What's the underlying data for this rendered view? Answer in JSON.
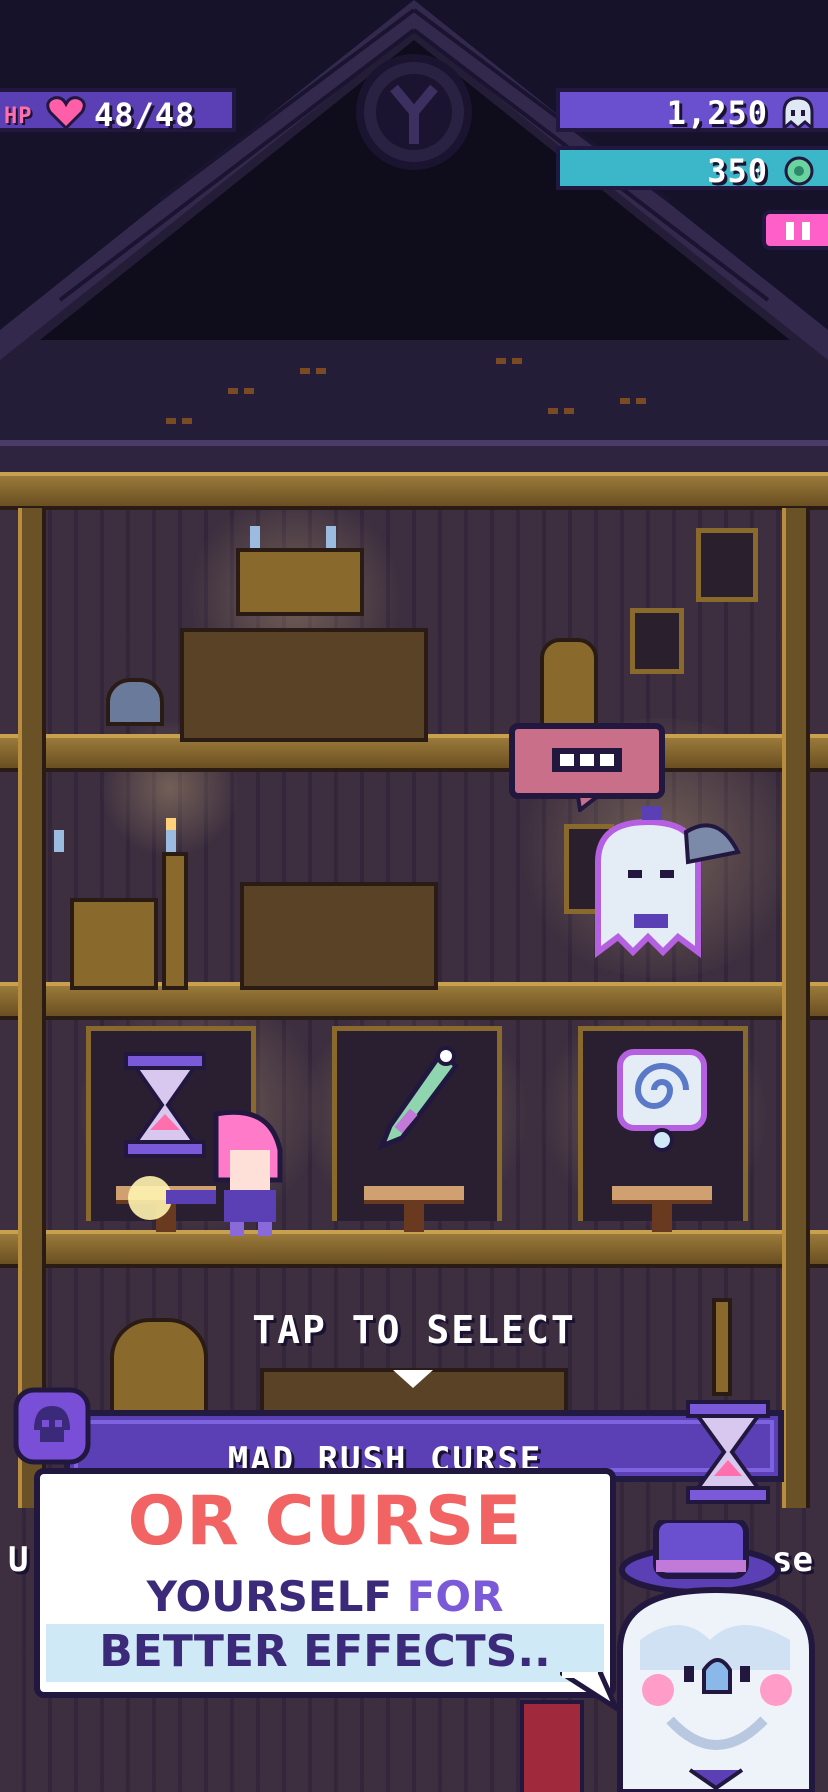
{
  "hud": {
    "hp_label": "HP",
    "hp_value": "48/48",
    "gold_value": "1,250",
    "gem_value": "350",
    "pause_icon": "pause-icon",
    "gold_icon": "ghost-coin-icon",
    "gem_icon": "gem-icon"
  },
  "scene": {
    "speech_text": "■■■",
    "items": [
      {
        "icon": "hourglass-heart-icon",
        "color": "#c27ad8"
      },
      {
        "icon": "bone-dagger-icon",
        "color": "#8fd6b0"
      },
      {
        "icon": "spiral-scroll-icon",
        "color": "#8aa8e0"
      }
    ]
  },
  "prompt": {
    "tap_text": "TAP TO SELECT"
  },
  "curse": {
    "name": "MAD RUSH CURSE",
    "desc_left": "U",
    "desc_right": "se"
  },
  "promo": {
    "line1": "OR CURSE",
    "line2_a": "YOURSELF",
    "line2_b": "FOR",
    "line3": "BETTER EFFECTS.."
  },
  "colors": {
    "accent_red": "#f26464",
    "accent_purple": "#5a3fb5",
    "accent_cyan": "#3bb7c9",
    "accent_pink": "#ff5fc8"
  }
}
